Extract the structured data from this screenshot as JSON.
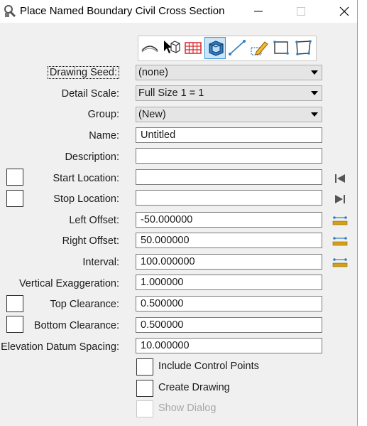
{
  "window": {
    "title": "Place Named Boundary Civil Cross Section",
    "icon": "wrench-tool-icon",
    "controls": [
      "minimize",
      "maximize-disabled",
      "close"
    ]
  },
  "toolbar": {
    "tools": [
      {
        "name": "civil-arc-tool",
        "icon": "arc-curve-icon"
      },
      {
        "name": "select-element-tool",
        "icon": "cursor-cube-icon"
      },
      {
        "name": "grid-tool",
        "icon": "red-grid-icon"
      },
      {
        "name": "cross-section-tool",
        "icon": "3d-box-icon",
        "active": true
      },
      {
        "name": "line-tool",
        "icon": "line-icon"
      },
      {
        "name": "draw-tool",
        "icon": "pencil-icon"
      },
      {
        "name": "rectangle-tool",
        "icon": "rectangle-icon"
      },
      {
        "name": "shape-tool",
        "icon": "polygon-icon"
      }
    ]
  },
  "fields": {
    "drawing_seed": {
      "label": "Drawing Seed:",
      "value": "(none)"
    },
    "detail_scale": {
      "label": "Detail Scale:",
      "value": "Full Size 1 = 1"
    },
    "group": {
      "label": "Group:",
      "value": "(New)"
    },
    "name": {
      "label": "Name:",
      "value": "Untitled"
    },
    "description": {
      "label": "Description:",
      "value": ""
    },
    "start_location": {
      "label": "Start Location:",
      "value": ""
    },
    "stop_location": {
      "label": "Stop Location:",
      "value": ""
    },
    "left_offset": {
      "label": "Left Offset:",
      "value": "-50.000000"
    },
    "right_offset": {
      "label": "Right Offset:",
      "value": "50.000000"
    },
    "interval": {
      "label": "Interval:",
      "value": "100.000000"
    },
    "vertical_exaggeration": {
      "label": "Vertical Exaggeration:",
      "value": "1.000000"
    },
    "top_clearance": {
      "label": "Top Clearance:",
      "value": "0.500000"
    },
    "bottom_clearance": {
      "label": "Bottom Clearance:",
      "value": "0.500000"
    },
    "elevation_datum_spacing": {
      "label": "Elevation Datum Spacing:",
      "value": "10.000000"
    }
  },
  "options": {
    "include_control_points": {
      "label": "Include Control Points",
      "checked": false
    },
    "create_drawing": {
      "label": "Create Drawing",
      "checked": false
    },
    "show_dialog": {
      "label": "Show Dialog",
      "checked": false,
      "disabled": true
    }
  },
  "colors": {
    "accent": "#3d9ad9",
    "ruler": "#d4a017",
    "grid": "#d9262b"
  }
}
